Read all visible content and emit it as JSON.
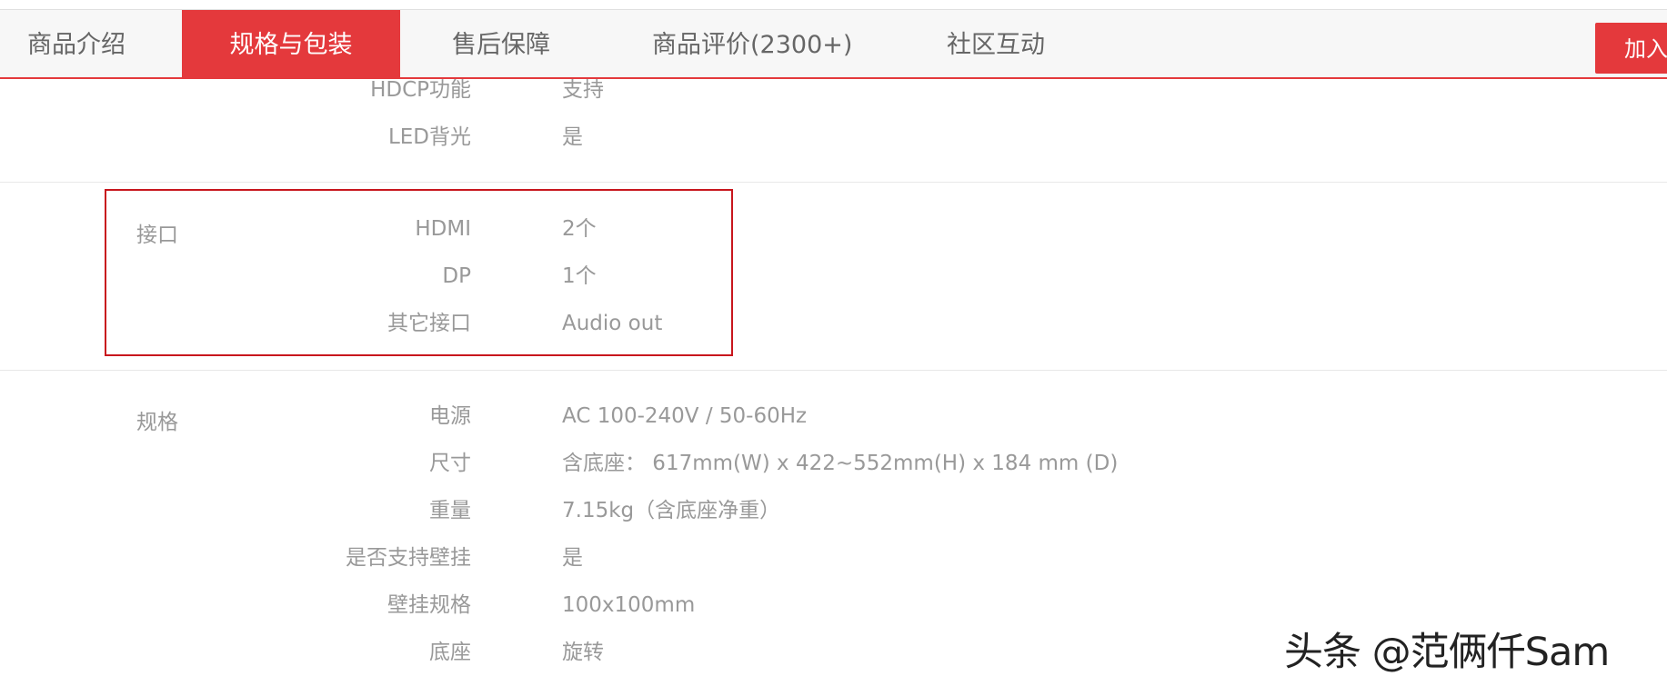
{
  "tabs": [
    {
      "label": "商品介绍",
      "active": false
    },
    {
      "label": "规格与包装",
      "active": true
    },
    {
      "label": "售后保障",
      "active": false
    },
    {
      "label": "商品评价(2300+)",
      "active": false
    },
    {
      "label": "社区互动",
      "active": false
    }
  ],
  "cart_button": "加入",
  "top_rows": [
    {
      "key": "HDCP功能",
      "value": "支持"
    },
    {
      "key": "LED背光",
      "value": "是"
    }
  ],
  "interface_group": {
    "title": "接口",
    "rows": [
      {
        "key": "HDMI",
        "value": "2个"
      },
      {
        "key": "DP",
        "value": "1个"
      },
      {
        "key": "其它接口",
        "value": "Audio out"
      }
    ]
  },
  "spec_group": {
    "title": "规格",
    "rows": [
      {
        "key": "电源",
        "value": "AC 100-240V / 50-60Hz"
      },
      {
        "key": "尺寸",
        "value": "含底座： 617mm(W) x 422~552mm(H) x 184 mm (D)"
      },
      {
        "key": "重量",
        "value": "7.15kg（含底座净重）"
      },
      {
        "key": "是否支持壁挂",
        "value": "是"
      },
      {
        "key": "壁挂规格",
        "value": "100x100mm"
      },
      {
        "key": "底座",
        "value": "旋转"
      }
    ]
  },
  "watermark": "头条 @范俩仟Sam",
  "colors": {
    "accent": "#e4393c",
    "highlight_border": "#c8161d",
    "tab_bar_bg": "#f7f7f7",
    "text_muted": "#999999"
  }
}
